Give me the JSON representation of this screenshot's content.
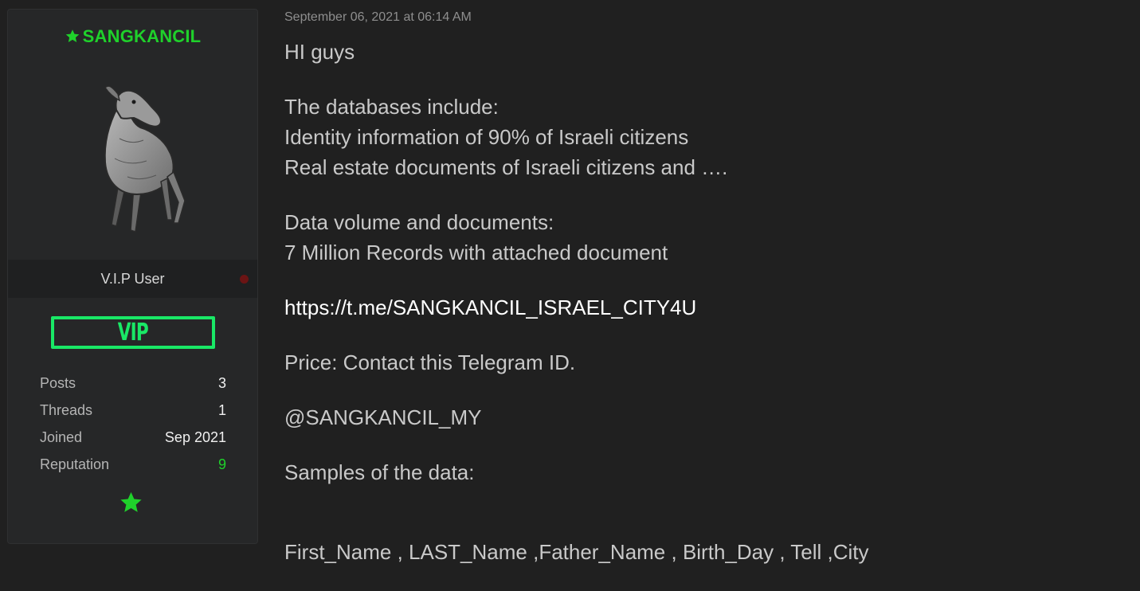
{
  "user": {
    "username": "SANGKANCIL",
    "user_title": "V.I.P User",
    "badge_text": "VIP",
    "stats": [
      {
        "label": "Posts",
        "value": "3"
      },
      {
        "label": "Threads",
        "value": "1"
      },
      {
        "label": "Joined",
        "value": "Sep 2021"
      },
      {
        "label": "Reputation",
        "value": "9"
      }
    ],
    "colors": {
      "username": "#1fd12b",
      "badge": "#19e866",
      "offline_dot": "#6b1414"
    },
    "icons": [
      "star-icon",
      "mouse-deer-avatar",
      "status-dot"
    ]
  },
  "post": {
    "date": "September 06, 2021 at 06:14 AM",
    "greeting": "HI guys",
    "db_heading": "The databases include:",
    "db_line1": "Identity information of 90% of Israeli citizens",
    "db_line2": "Real estate documents of Israeli citizens and ….",
    "volume_heading": "Data volume and documents:",
    "volume_line": "7 Million Records with attached document",
    "link": "https://t.me/SANGKANCIL_ISRAEL_CITY4U",
    "price": "Price: Contact this Telegram ID.",
    "telegram_id": "@SANGKANCIL_MY",
    "samples_heading": "Samples of the data:",
    "columns_line": "First_Name , LAST_Name ,Father_Name , Birth_Day , Tell ,City"
  }
}
